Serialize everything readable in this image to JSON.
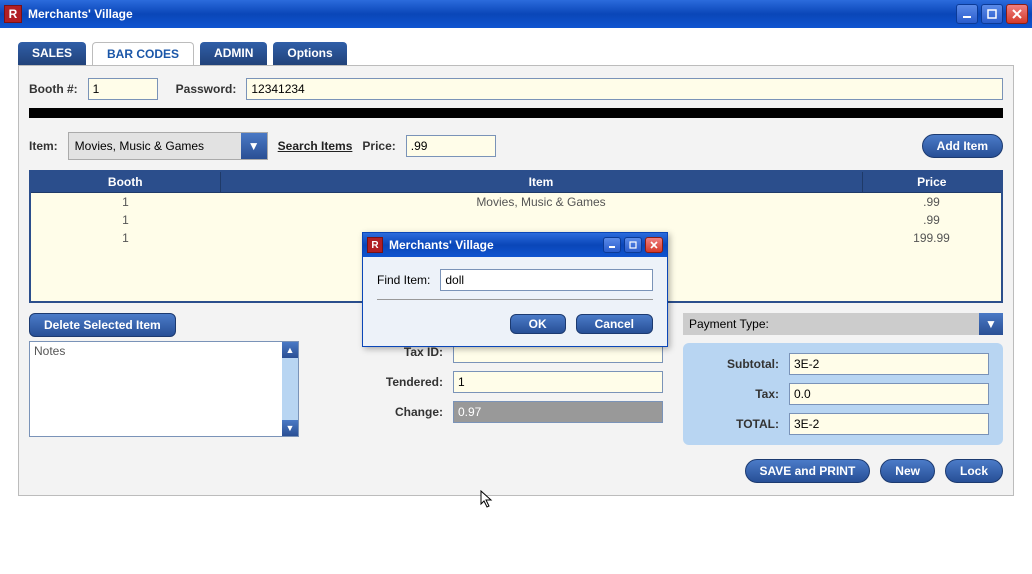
{
  "window": {
    "title": "Merchants' Village",
    "icon_letter": "R"
  },
  "tabs": [
    "SALES",
    "BAR CODES",
    "ADMIN",
    "Options"
  ],
  "active_tab": 1,
  "booth": {
    "label": "Booth #:",
    "value": "1"
  },
  "password": {
    "label": "Password:",
    "value": "12341234"
  },
  "item": {
    "label": "Item:",
    "select_value": "Movies, Music & Games",
    "search_link": "Search Items",
    "price_label": "Price:",
    "price_value": ".99",
    "add_button": "Add Item"
  },
  "table": {
    "headers": [
      "Booth",
      "Item",
      "Price"
    ],
    "rows": [
      {
        "booth": "1",
        "item": "Movies, Music & Games",
        "price": ".99"
      },
      {
        "booth": "1",
        "item": "",
        "price": ".99"
      },
      {
        "booth": "1",
        "item": "",
        "price": "199.99"
      }
    ]
  },
  "delete_button": "Delete Selected Item",
  "notes_label": "Notes",
  "payment_type_label": "Payment Type:",
  "payment_type_value": "",
  "calc": {
    "taxid": {
      "label": "Tax ID:",
      "value": ""
    },
    "tendered": {
      "label": "Tendered:",
      "value": "1"
    },
    "change": {
      "label": "Change:",
      "value": "0.97"
    }
  },
  "totals": {
    "subtotal": {
      "label": "Subtotal:",
      "value": "3E-2"
    },
    "tax": {
      "label": "Tax:",
      "value": "0.0"
    },
    "total": {
      "label": "TOTAL:",
      "value": "3E-2"
    }
  },
  "footer_buttons": {
    "save": "SAVE and PRINT",
    "new": "New",
    "lock": "Lock"
  },
  "modal": {
    "title": "Merchants' Village",
    "icon_letter": "R",
    "find_label": "Find Item:",
    "find_value": "doll",
    "ok": "OK",
    "cancel": "Cancel"
  }
}
